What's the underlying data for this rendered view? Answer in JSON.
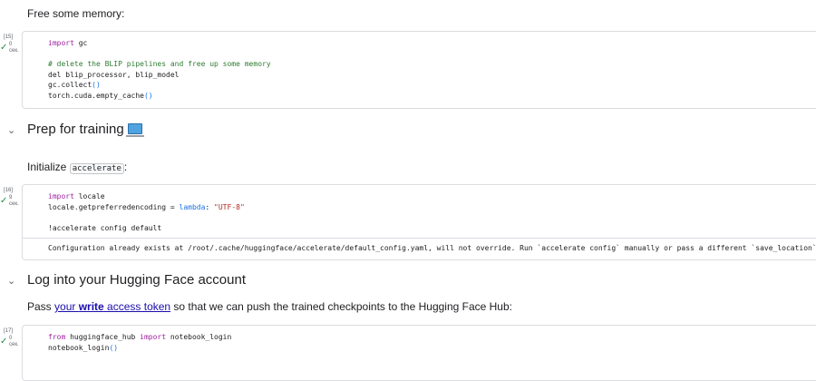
{
  "sections": {
    "free_memory_text": "Free some memory:",
    "prep_heading": "Prep for training",
    "init_prefix": "Initialize ",
    "init_code": "accelerate",
    "init_suffix": ":",
    "login_heading": "Log into your Hugging Face account",
    "pass_prefix": "Pass ",
    "pass_link_a": "your ",
    "pass_link_b": "write",
    "pass_link_c": " access token",
    "pass_suffix": " so that we can push the trained checkpoints to the Hugging Face Hub:"
  },
  "cells": [
    {
      "exec_count": "[15]",
      "status_num": "0",
      "status_unit": "сек.",
      "code": {
        "l1_kw": "import",
        "l1_rest": " gc",
        "l3_comment": "# delete the BLIP pipelines and free up some memory",
        "l4": "del blip_processor, blip_model",
        "l5_a": "gc.collect",
        "l5_b": "()",
        "l6_a": "torch.cuda.empty_cache",
        "l6_b": "()"
      }
    },
    {
      "exec_count": "[16]",
      "status_num": "9",
      "status_unit": "сек.",
      "code": {
        "l1_kw": "import",
        "l1_rest": " locale",
        "l2_a": "locale.getpreferredencoding = ",
        "l2_kw": "lambda",
        "l2_b": ": ",
        "l2_str": "\"UTF-8\"",
        "l4": "!accelerate config default"
      },
      "output": "Configuration already exists at /root/.cache/huggingface/accelerate/default_config.yaml, will not override. Run `accelerate config` manually or pass a different `save_location`."
    },
    {
      "exec_count": "[17]",
      "status_num": "0",
      "status_unit": "сек.",
      "code": {
        "l1_kw1": "from",
        "l1_mid": " huggingface_hub ",
        "l1_kw2": "import",
        "l1_rest": " notebook_login",
        "l2_a": "notebook_login",
        "l2_b": "()"
      }
    }
  ],
  "icons": {
    "collapse": "chevron-down-icon",
    "status": "check-icon",
    "heading_emoji": "laptop-icon"
  }
}
